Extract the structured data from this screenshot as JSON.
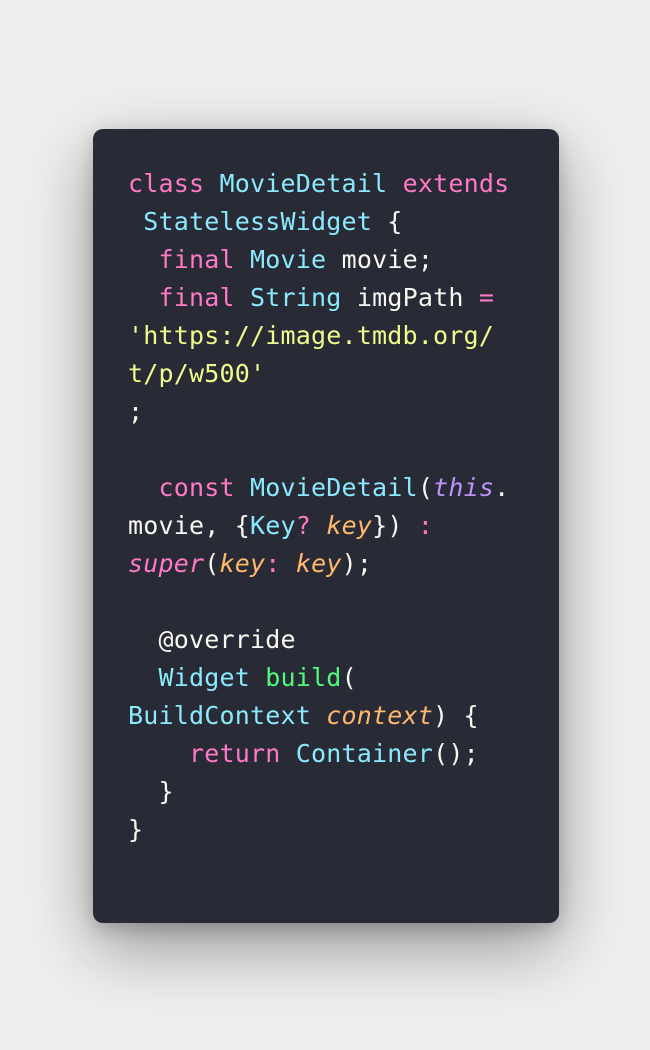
{
  "colors": {
    "page_background": "#efefef",
    "card_background": "#282a36",
    "keyword": "#ff79c6",
    "type": "#8be9fd",
    "plain": "#f8f8f2",
    "string": "#f1fa8c",
    "function": "#50fa7b",
    "this_keyword": "#bd93f9",
    "parameter": "#ffb86c"
  },
  "code_lines": [
    [
      "class",
      " ",
      "MovieDetail",
      " ",
      "extends"
    ],
    [
      " ",
      "StatelessWidget",
      " {"
    ],
    [
      "  ",
      "final",
      " ",
      "Movie",
      " movie;"
    ],
    [
      "  ",
      "final",
      " ",
      "String",
      " imgPath ",
      "="
    ],
    [
      "'https://image.tmdb.org/"
    ],
    [
      "t/p/w500'"
    ],
    [
      ";"
    ],
    [
      ""
    ],
    [
      "  ",
      "const",
      " ",
      "MovieDetail",
      "(",
      "this",
      "."
    ],
    [
      "movie, {",
      "Key",
      "?",
      " ",
      "key",
      "}) ",
      ":"
    ],
    [
      "super",
      "(",
      "key",
      ":",
      " ",
      "key",
      ");"
    ],
    [
      ""
    ],
    [
      "  @override"
    ],
    [
      "  ",
      "Widget",
      " ",
      "build",
      "("
    ],
    [
      "BuildContext",
      " ",
      "context",
      ") {"
    ],
    [
      "    ",
      "return",
      " ",
      "Container",
      "();"
    ],
    [
      "  }"
    ],
    [
      "}"
    ]
  ]
}
